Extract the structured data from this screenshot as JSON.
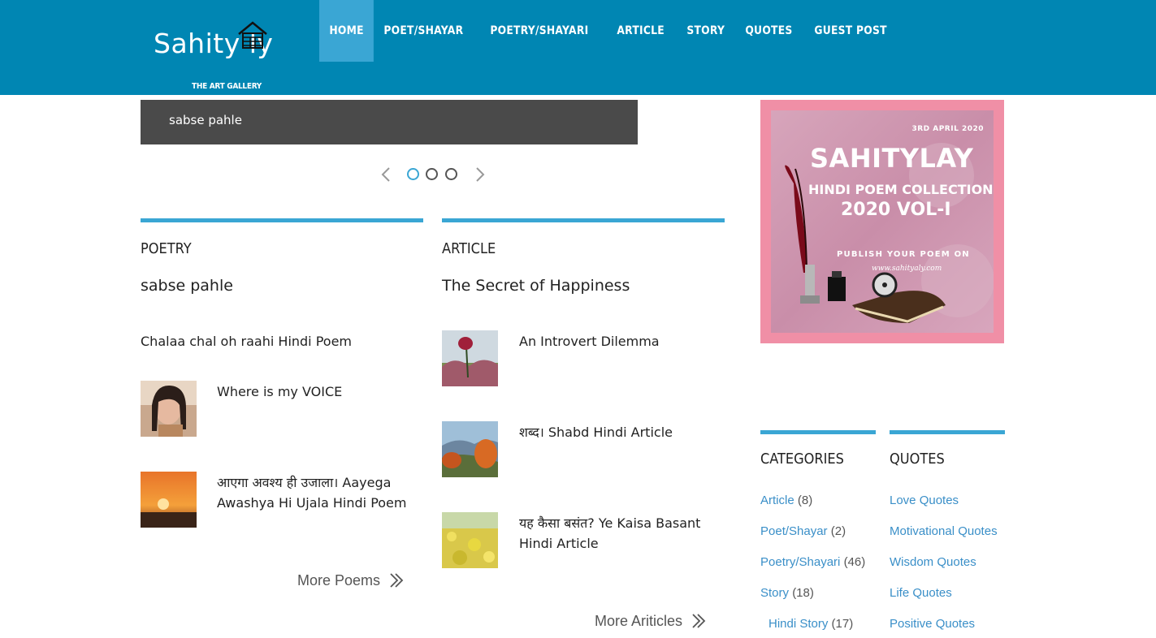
{
  "site": {
    "logo_text": "Sahity  ly",
    "tagline": "THE ART GALLERY"
  },
  "nav": [
    {
      "label": "HOME",
      "active": true
    },
    {
      "label": "POET/SHAYAR"
    },
    {
      "label": "POETRY/SHAYARI"
    },
    {
      "label": "ARTICLE"
    },
    {
      "label": "STORY"
    },
    {
      "label": "QUOTES"
    },
    {
      "label": "GUEST POST"
    }
  ],
  "slider": {
    "caption": "sabse pahle",
    "dots": 3,
    "active_dot": 1
  },
  "poetry": {
    "title": "POETRY",
    "featured": "sabse pahle",
    "items": [
      "Chalaa chal oh raahi Hindi Poem",
      "Where is my VOICE",
      "आएगा अवश्य ही उजाला। Aayega Awashya Hi Ujala Hindi Poem"
    ],
    "more": "More Poems"
  },
  "article": {
    "title": "ARTICLE",
    "featured": "The Secret of Happiness",
    "items": [
      "An Introvert Dilemma",
      "शब्द। Shabd Hindi Article",
      "यह कैसा बसंत? Ye Kaisa Basant Hindi Article"
    ],
    "more": "More Ariticles"
  },
  "ad": {
    "date": "3RD APRIL 2020",
    "title": "SAHITYLAY",
    "line2": "HINDI POEM COLLECTION",
    "line3": "2020 VOL-I",
    "line4": "PUBLISH YOUR POEM ON",
    "line5": "www.sahityaly.com"
  },
  "categories": {
    "title": "CATEGORIES",
    "items": [
      {
        "label": "Article",
        "count": "(8)"
      },
      {
        "label": "Poet/Shayar",
        "count": "(2)"
      },
      {
        "label": "Poetry/Shayari",
        "count": "(46)"
      },
      {
        "label": "Story",
        "count": "(18)"
      },
      {
        "label": "Hindi Story",
        "count": "(17)"
      }
    ]
  },
  "quotes": {
    "title": "QUOTES",
    "items": [
      "Love Quotes",
      "Motivational Quotes",
      "Wisdom Quotes",
      "Life Quotes",
      "Positive Quotes"
    ]
  },
  "colors": {
    "header": "#0086b3",
    "nav_active": "#3aa6d4",
    "accent": "#3aa6d4",
    "link": "#3a8fc8",
    "ad_border": "#f08fa6"
  }
}
